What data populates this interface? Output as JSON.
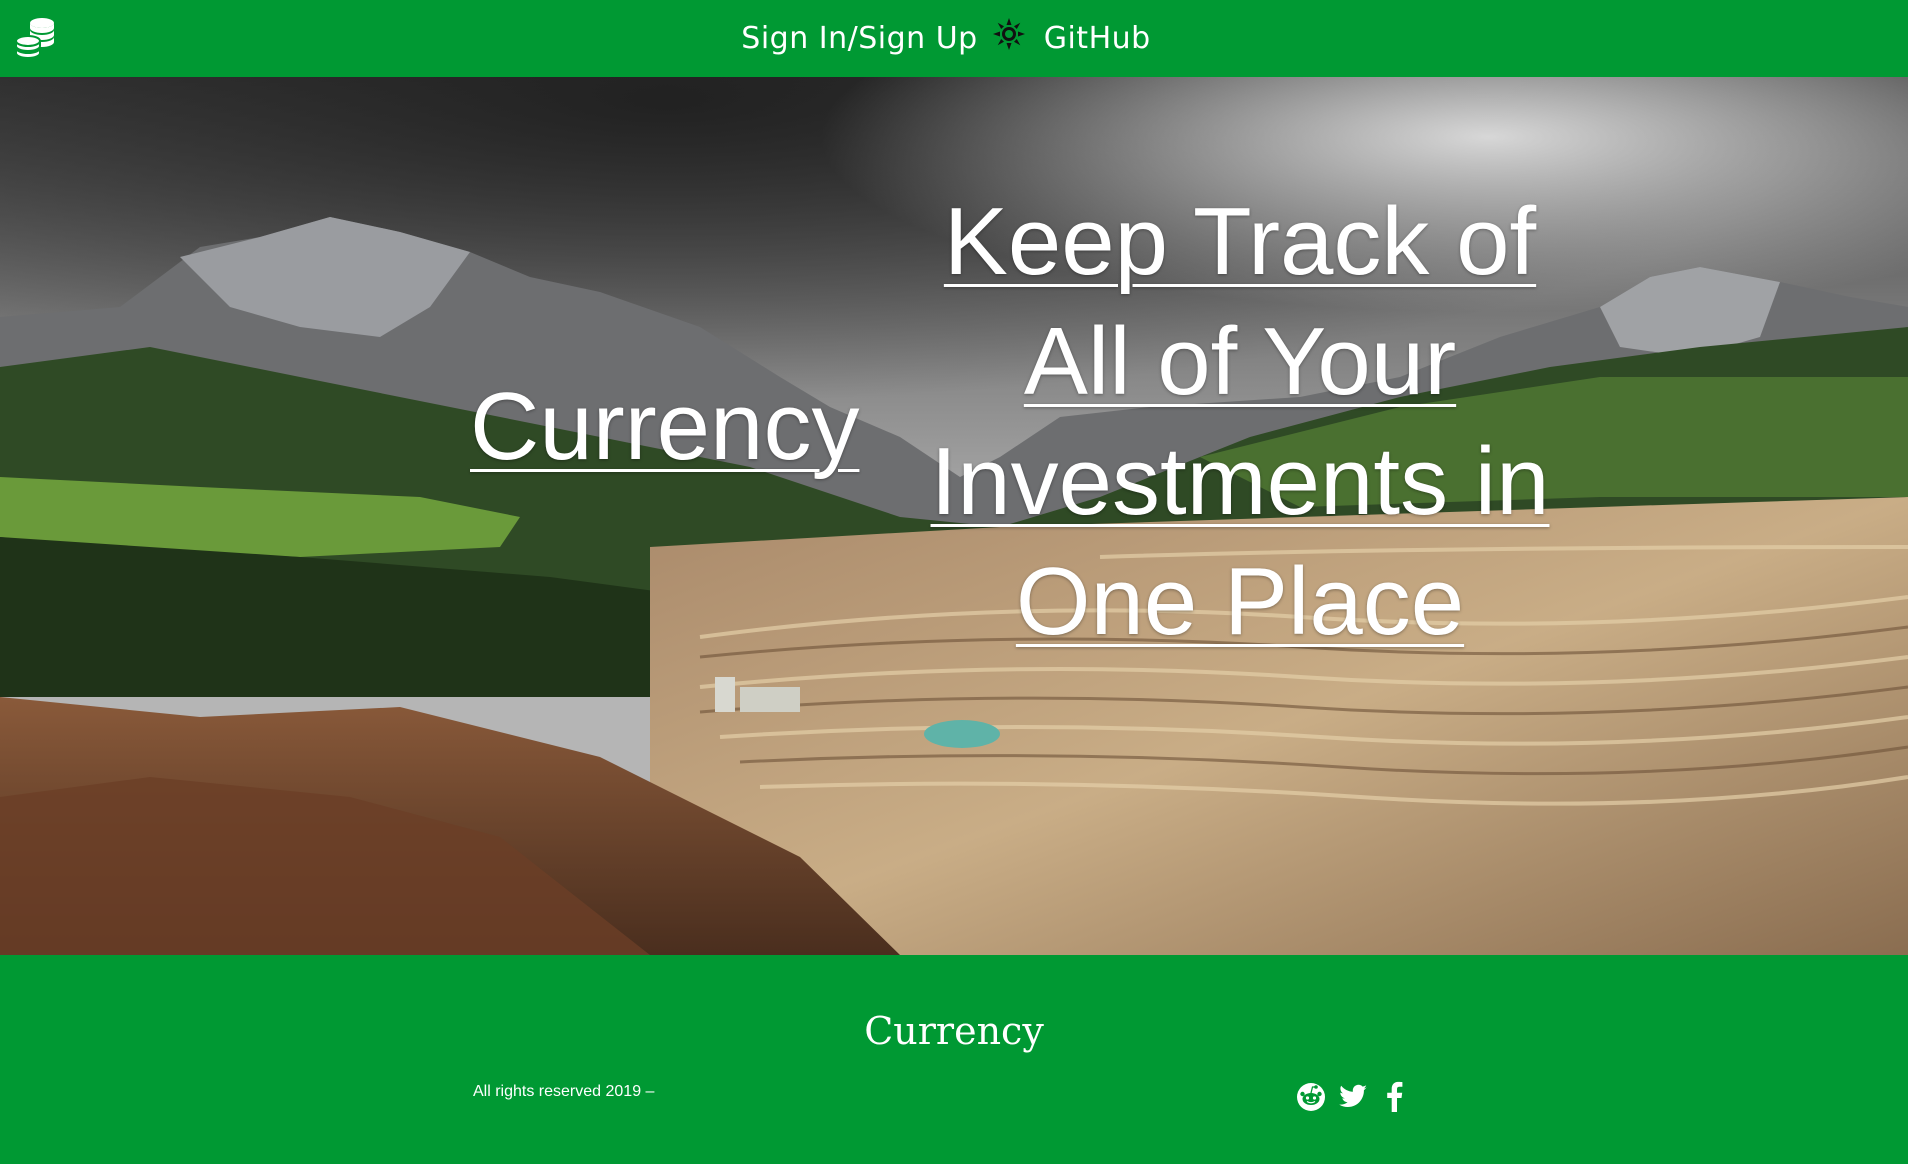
{
  "navbar": {
    "logo_icon": "coins-stack-icon",
    "links": {
      "signin": "Sign In/Sign Up",
      "theme_icon": "sun-icon",
      "github": "GitHub"
    }
  },
  "hero": {
    "brand": "Currency",
    "tagline": "Keep Track of All of Your Investments in One Place"
  },
  "footer": {
    "brand": "Currency",
    "copyright": "All rights reserved 2019 –",
    "social_icons": [
      "reddit-icon",
      "twitter-icon",
      "facebook-icon"
    ]
  },
  "colors": {
    "brand_green": "#009933",
    "text": "#ffffff"
  }
}
